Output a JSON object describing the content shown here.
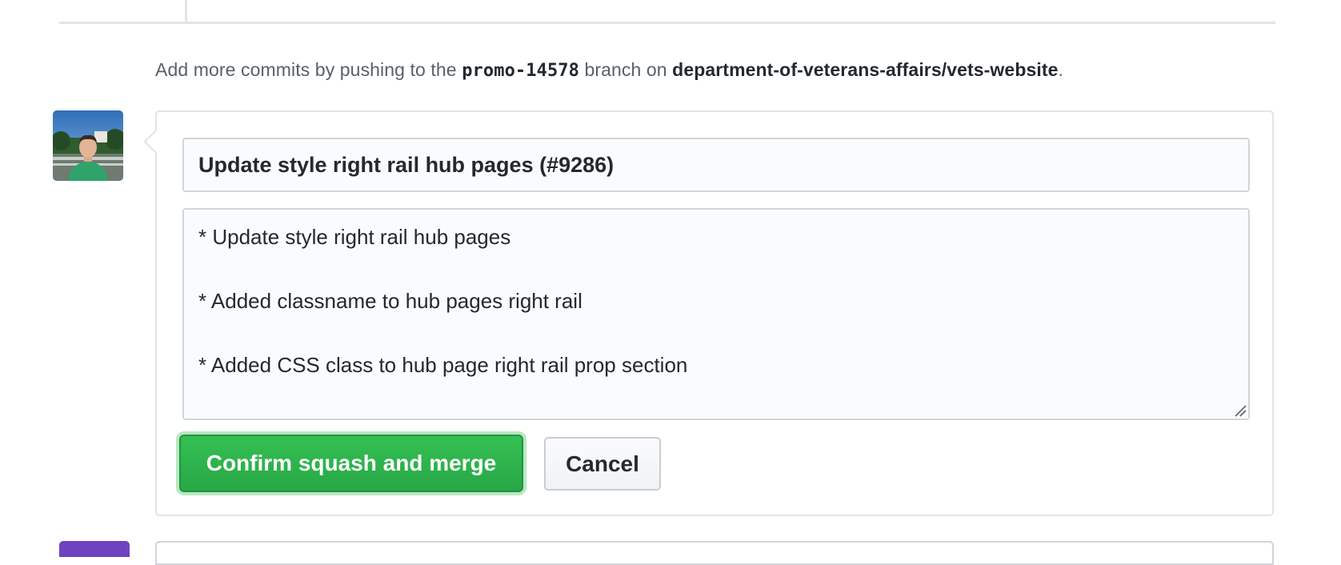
{
  "hint": {
    "prefix": "Add more commits by pushing to the ",
    "branch": "promo-14578",
    "middle": " branch on ",
    "repo": "department-of-veterans-affairs/vets-website",
    "suffix": "."
  },
  "merge": {
    "commit_title": "Update style right rail hub pages (#9286)",
    "commit_body": "* Update style right rail hub pages\n\n* Added classname to hub pages right rail\n\n* Added CSS class to hub page right rail prop section",
    "confirm_label": "Confirm squash and merge",
    "cancel_label": "Cancel"
  },
  "colors": {
    "confirm_green": "#28a745",
    "next_badge_purple": "#6f42c1",
    "border_gray": "#e1e4e8"
  },
  "icons": {
    "avatar": "user-avatar-photo",
    "resize": "resize-grip-icon"
  }
}
